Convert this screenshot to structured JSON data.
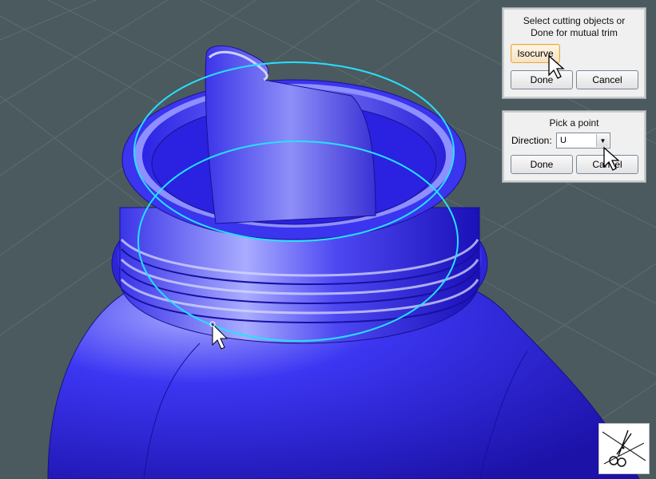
{
  "trim_panel": {
    "prompt_line1": "Select cutting objects or",
    "prompt_line2": "Done for mutual trim",
    "isocurve_label": "Isocurve",
    "done_label": "Done",
    "cancel_label": "Cancel"
  },
  "point_panel": {
    "prompt": "Pick a point",
    "direction_label": "Direction:",
    "direction_value": "U",
    "done_label": "Done",
    "cancel_label": "Cancel"
  },
  "toolbar": {
    "tool_icon": "scissors-trim-icon"
  },
  "colors": {
    "viewport_bg": "#4b5a5e",
    "grid": "#5c6b70",
    "model": "#2a22e0",
    "isocurve": "#27e0ff",
    "highlight_border": "#e8a84a"
  }
}
